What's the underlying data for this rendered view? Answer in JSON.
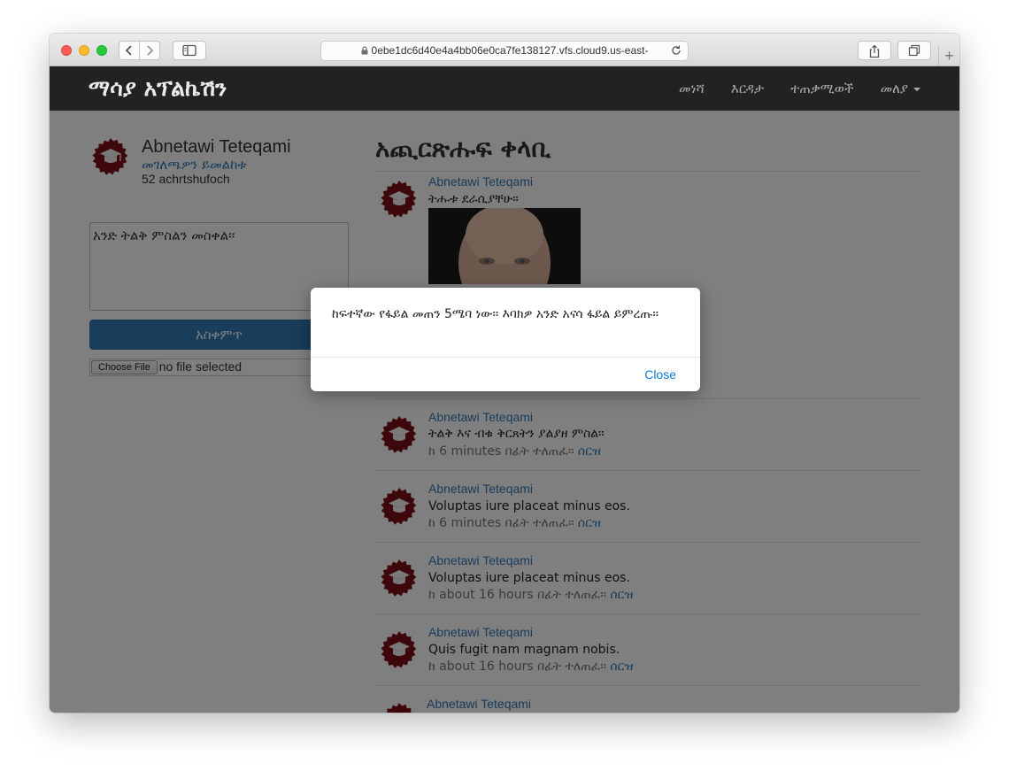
{
  "browser": {
    "url": "0ebe1dc6d40e4a4bb06e0ca7fe138127.vfs.cloud9.us-east-",
    "new_tab": "+"
  },
  "navbar": {
    "brand": "ማሳያ አፕልኬሽን",
    "links": {
      "home": "መነሻ",
      "help": "እርዳታ",
      "users": "ተጠቃሚወች",
      "account": "መለያ"
    }
  },
  "sidebar": {
    "user_name": "Abnetawi Teteqami",
    "profile_link": "መገለጫዎን ይመልከቱ",
    "micropost_count": "52 achrtshufoch",
    "textarea_placeholder": "አንድ ትልቅ ምስልን መስቀል፡፡",
    "post_button": "አስቀምጥ",
    "choose_file": "Choose File",
    "no_file": "no file selected"
  },
  "feed": {
    "title": "አጪርጽሑፍ ቀላቢ",
    "items": [
      {
        "user": "Abnetawi Teteqami",
        "text": "ትሑቱ ደራሲያቸሁ፡፡"
      },
      {
        "user": "Abnetawi Teteqami",
        "text": "ትልቅ እና ብቁ ቅርጸትን ያልያዘ ምስል፡፡",
        "time": "ከ 6 minutes በፊት ተለጠፈ፡፡",
        "delete": "ሰርዝ"
      },
      {
        "user": "Abnetawi Teteqami",
        "text": "Voluptas iure placeat minus eos.",
        "time": "ከ 6 minutes በፊት ተለጠፈ፡፡",
        "delete": "ሰርዝ"
      },
      {
        "user": "Abnetawi Teteqami",
        "text": "Voluptas iure placeat minus eos.",
        "time": "ከ about 16 hours በፊት ተለጠፈ፡፡",
        "delete": "ሰርዝ"
      },
      {
        "user": "Abnetawi Teteqami",
        "text": "Quis fugit nam magnam nobis.",
        "time": "ከ about 16 hours በፊት ተለጠፈ፡፡",
        "delete": "ሰርዝ"
      },
      {
        "user": "Abnetawi Teteqami"
      }
    ]
  },
  "modal": {
    "message": "ከፍተኛው የፋይል መጠን 5ሜባ ነው፡፡ እባክዎ አንድ አናሳ ፋይል ይምረጡ፡፡",
    "close": "Close"
  },
  "colors": {
    "gravatar": "#7a0f16",
    "link": "#337ab7",
    "navbar": "#222222",
    "primary_button": "#337ab7"
  }
}
